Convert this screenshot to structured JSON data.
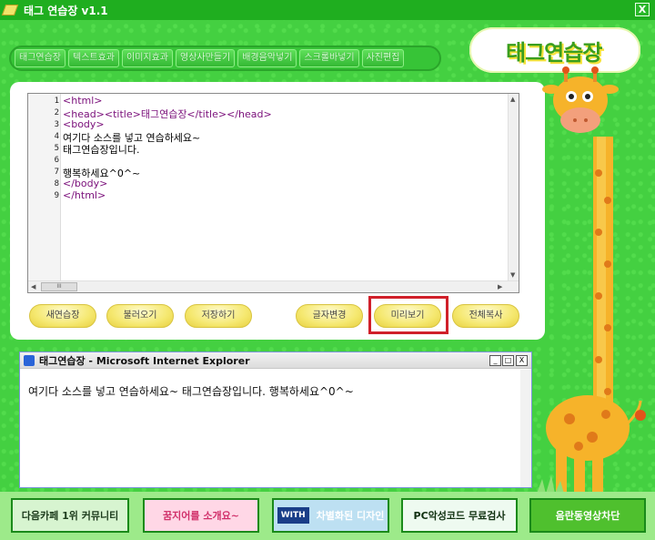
{
  "window": {
    "title": "태그 연습장 v1.1",
    "close_label": "X"
  },
  "menu": [
    "태그연습장",
    "텍스트효과",
    "이미지효과",
    "영상사만들기",
    "배경음악넣기",
    "스크롤바넣기",
    "사진편집"
  ],
  "logo": {
    "text": "태그연습장"
  },
  "editor": {
    "line_numbers": [
      "1",
      "2",
      "3",
      "4",
      "5",
      "6",
      "7",
      "8",
      "9"
    ],
    "lines": [
      "<html>",
      "<head><title>태그연습장</title></head>",
      "<body>",
      "여기다 소스를 넣고 연습하세요~",
      "태그연습장입니다.",
      "",
      "행복하세요^0^~",
      "</body>",
      "</html>"
    ],
    "scroll_thumb": "III"
  },
  "buttons": {
    "new": "새연습장",
    "load": "불러오기",
    "save": "저장하기",
    "font": "글자변경",
    "preview": "미리보기",
    "copy_all": "전체복사"
  },
  "ie": {
    "title": "태그연습장 - Microsoft Internet Explorer",
    "minimize": "_",
    "maximize": "□",
    "close": "X",
    "content": "여기다 소스를 넣고 연습하세요~ 태그연습장입니다. 행복하세요^0^~"
  },
  "footer": {
    "community": "다음카페 1위 커뮤니티",
    "banner2": "꿈지어를 소개요~",
    "with_brand": "WITH",
    "with_text": "차별화된 디자인",
    "virus": "PC악성코드 무료검사",
    "block": "음란동영상차단"
  },
  "colors": {
    "app_green": "#44d041",
    "highlight": "#d0202a",
    "button_yellow": "#f5e870"
  }
}
